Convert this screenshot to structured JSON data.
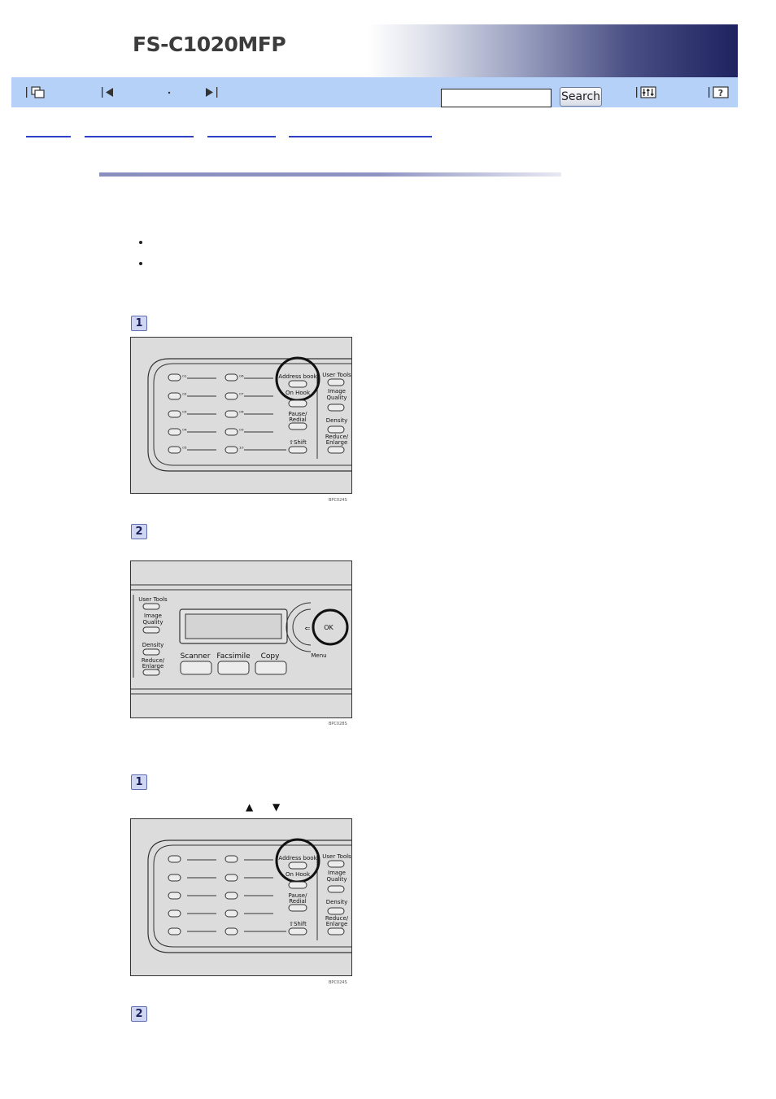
{
  "header": {
    "title": "FS-C1020MFP"
  },
  "toolbar": {
    "icons": [
      "windows-icon",
      "previous-icon",
      "dot-icon",
      "next-icon",
      "settings-icon",
      "help-icon"
    ],
    "search_placeholder": "",
    "search_label": "Search"
  },
  "breadcrumb": {
    "links": 4
  },
  "figures": [
    {
      "code": "BPC024S",
      "buttons": {
        "address_book": "Address book",
        "on_hook": "On Hook",
        "pause": "Pause/",
        "redial": "Redial",
        "shift": "⇧Shift",
        "user_tools": "User Tools",
        "image": "Image",
        "quality": "Quality",
        "density": "Density",
        "reduce": "Reduce/",
        "enlarge": "Enlarge"
      }
    },
    {
      "code": "BPC028S",
      "buttons": {
        "user_tools": "User Tools",
        "image": "Image",
        "quality": "Quality",
        "density": "Density",
        "reduce": "Reduce/",
        "enlarge": "Enlarge",
        "scanner": "Scanner",
        "facsimile": "Facsimile",
        "copy": "Copy",
        "ok": "OK",
        "menu": "Menu"
      }
    },
    {
      "code": "BPC024S"
    }
  ],
  "steps": [
    "1",
    "2",
    "1",
    "2"
  ],
  "arrows": "▲ ▼",
  "colors": {
    "toolbar": "#b6d1f8",
    "link": "#2e41c6",
    "step_bg": "#cfd6f2"
  }
}
